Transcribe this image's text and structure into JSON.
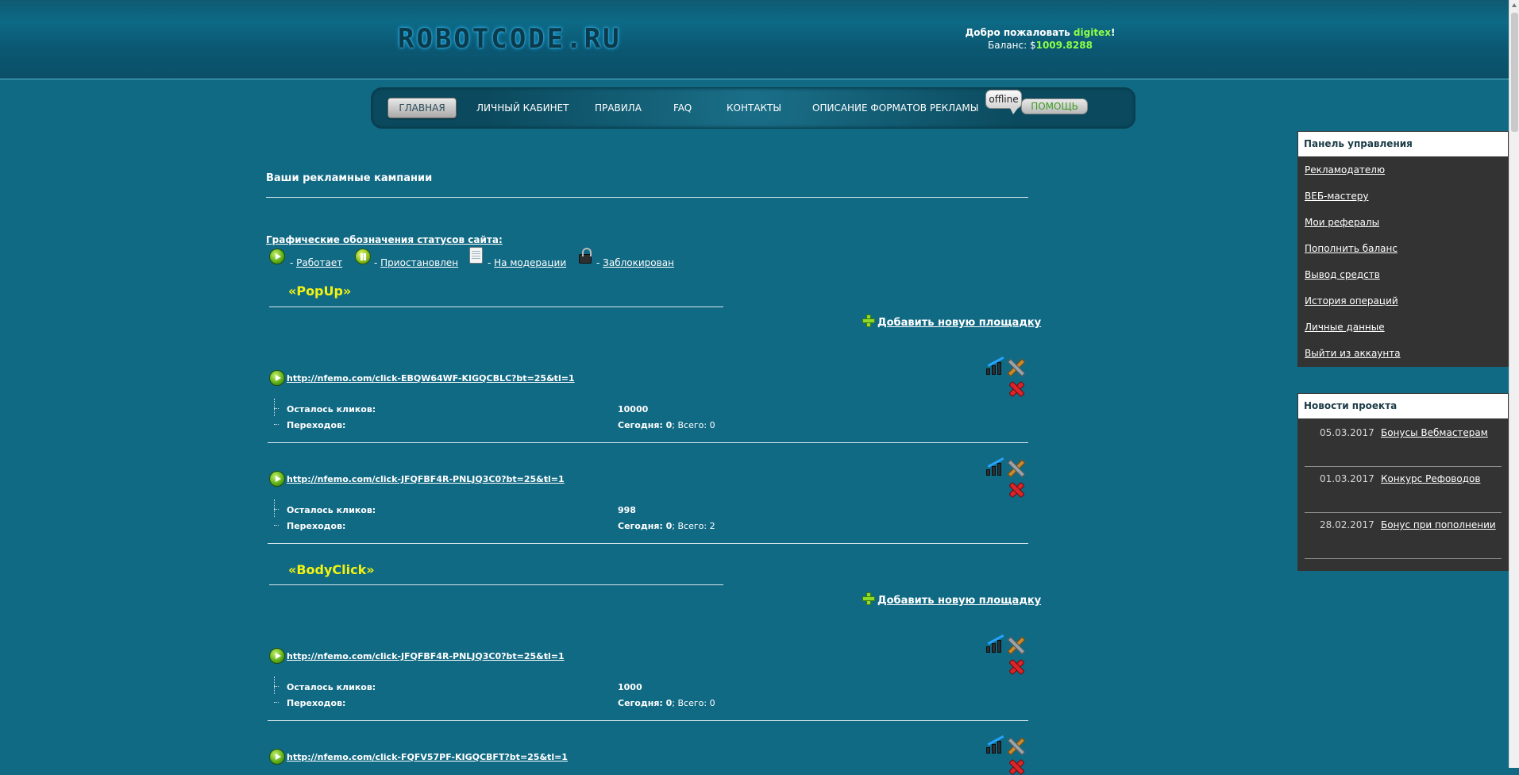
{
  "header": {
    "logo": "ROBOTCODE.RU",
    "welcome_prefix": "Добро пожаловать ",
    "username": "digitex",
    "welcome_suffix": "!",
    "balance_label": "Баланс: $",
    "balance_value": "1009.8288"
  },
  "nav": {
    "items": [
      "ГЛАВНАЯ",
      "ЛИЧНЫЙ КАБИНЕТ",
      "ПРАВИЛА",
      "FAQ",
      "КОНТАКТЫ",
      "ОПИСАНИЕ ФОРМАТОВ РЕКЛАМЫ"
    ],
    "offline_label": "offline",
    "help_label": "ПОМОЩЬ"
  },
  "main": {
    "title": "Ваши рекламные кампании",
    "legend_title": "Графические обозначения статусов сайта:",
    "legend": [
      {
        "icon": "play-icon",
        "prefix": " - ",
        "label": "Работает"
      },
      {
        "icon": "pause-icon",
        "prefix": " - ",
        "label": "Приостановлен"
      },
      {
        "icon": "notepad-icon",
        "prefix": " - ",
        "label": "На модерации"
      },
      {
        "icon": "lock-icon",
        "prefix": " - ",
        "label": "Заблокирован"
      }
    ],
    "add_site_label": "Добавить новую площадку",
    "clicks_left_label": "Осталось кликов:",
    "transitions_label": "Переходов:",
    "today_label": "Сегодня: ",
    "total_label": "; Всего: ",
    "sections": [
      {
        "title": "«PopUp»",
        "campaigns": [
          {
            "url": "http://nfemo.com/click-EBQW64WF-KIGQCBLC?bt=25&tl=1",
            "dash": " -",
            "clicks_left": "10000",
            "today": "0",
            "total": "0"
          },
          {
            "url": "http://nfemo.com/click-JFQFBF4R-PNLJQ3C0?bt=25&tl=1",
            "dash": " -",
            "clicks_left": "998",
            "today": "0",
            "total": "2"
          }
        ]
      },
      {
        "title": "«BodyClick»",
        "campaigns": [
          {
            "url": "http://nfemo.com/click-JFQFBF4R-PNLJQ3C0?bt=25&tl=1",
            "dash": " -",
            "clicks_left": "1000",
            "today": "0",
            "total": "0"
          },
          {
            "url": "http://nfemo.com/click-FQFV57PF-KIGQCBFT?bt=25&tl=1",
            "dash": " -"
          }
        ]
      }
    ]
  },
  "control_panel": {
    "title": "Панель управления",
    "links": [
      "Рекламодателю",
      "ВЕБ-мастеру",
      "Мои рефералы",
      "Пополнить баланс",
      "Вывод средств",
      "История операций",
      "Личные данные",
      "Выйти из аккаунта"
    ]
  },
  "news": {
    "title": "Новости проекта",
    "items": [
      {
        "date": "05.03.2017",
        "title": "Бонусы Вебмастерам"
      },
      {
        "date": "01.03.2017",
        "title": "Конкурс Рефоводов"
      },
      {
        "date": "28.02.2017",
        "title": "Бонус при пополнении"
      }
    ]
  },
  "colors": {
    "background": "#116a84",
    "accent_green": "#8dff45",
    "section_yellow": "#f3f310",
    "panel_dark": "#333333"
  }
}
